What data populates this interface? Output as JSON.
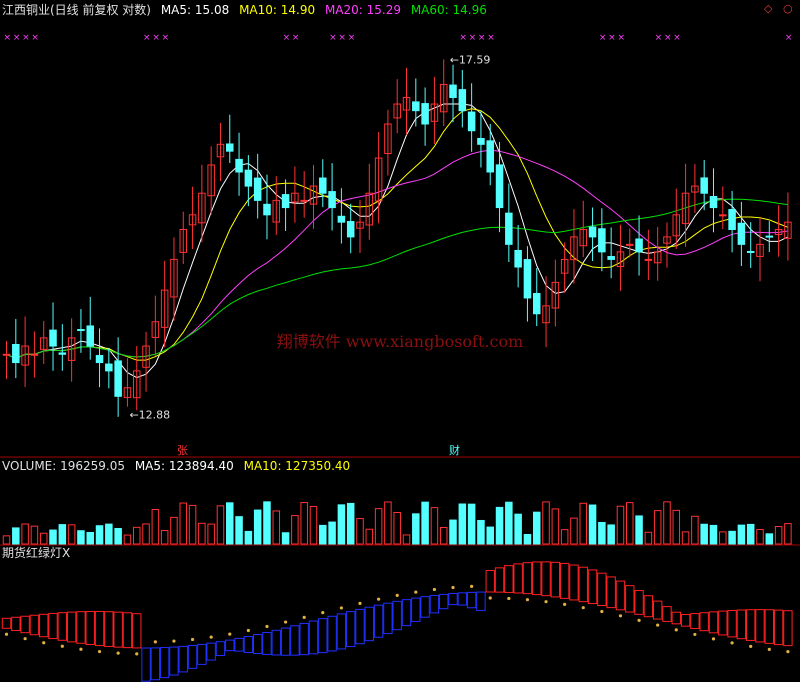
{
  "header": {
    "symbol": "江西铜业(日线 前复权 对数)",
    "ma5": "MA5: 15.08",
    "ma10": "MA10: 14.90",
    "ma20": "MA20: 15.29",
    "ma60": "MA60: 14.96"
  },
  "volume_header": {
    "volume": "VOLUME: 196259.05",
    "ma5": "MA5: 123894.40",
    "ma10": "MA10: 127350.40"
  },
  "indicator_header": {
    "name": "期货红绿灯X"
  },
  "watermark": "翔博软件 www.xiangbosoft.com",
  "markers": {
    "zhang": "张",
    "cai": "财"
  },
  "icons": {
    "top_right": [
      "diamond-icon",
      "circle-icon"
    ]
  },
  "colors": {
    "up": "#ff3232",
    "down": "#54ffff",
    "ma5": "#ffffff",
    "ma10": "#ffff00",
    "ma20": "#ff40ff",
    "ma60": "#00e000",
    "grid": "#a00000",
    "signal": "#ff40ff",
    "ind_red": "#ff2020",
    "ind_blue": "#2030ff",
    "ind_gold": "#e0b040"
  },
  "chart_data": [
    {
      "type": "candlestick",
      "title": "江西铜业(日线 前复权 对数)",
      "annotations": [
        "17.59",
        "12.88"
      ],
      "high_label": "17.59",
      "low_label": "12.88",
      "high": 17.59,
      "low": 12.88,
      "ylim": [
        12.5,
        17.9
      ],
      "closes": [
        13.5,
        13.4,
        13.6,
        13.5,
        13.7,
        13.6,
        13.5,
        13.7,
        13.8,
        13.6,
        13.4,
        13.3,
        13.0,
        13.1,
        13.3,
        13.6,
        13.9,
        14.3,
        14.7,
        15.1,
        15.3,
        15.6,
        16.0,
        16.3,
        16.2,
        15.9,
        15.7,
        15.5,
        15.3,
        15.5,
        15.4,
        15.6,
        15.5,
        15.7,
        15.6,
        15.4,
        15.2,
        15.0,
        15.2,
        15.6,
        16.1,
        16.6,
        16.9,
        17.0,
        16.8,
        16.6,
        16.9,
        17.2,
        17.0,
        16.8,
        16.5,
        16.3,
        15.9,
        15.4,
        14.9,
        14.6,
        14.2,
        14.0,
        14.1,
        14.4,
        14.7,
        15.0,
        15.1,
        15.0,
        14.8,
        14.7,
        14.8,
        14.9,
        14.8,
        14.7,
        14.8,
        15.0,
        15.3,
        15.6,
        15.7,
        15.6,
        15.4,
        15.3,
        15.1,
        14.9,
        14.8,
        14.9,
        15.0,
        15.1,
        15.2
      ]
    },
    {
      "type": "line",
      "series": [
        {
          "name": "MA5",
          "value": 15.08
        },
        {
          "name": "MA10",
          "value": 14.9
        },
        {
          "name": "MA20",
          "value": 15.29
        },
        {
          "name": "MA60",
          "value": 14.96
        }
      ]
    },
    {
      "type": "bar",
      "title": "VOLUME",
      "last": 196259.05,
      "ma5": 123894.4,
      "ma10": 127350.4
    },
    {
      "type": "area",
      "title": "期货红绿灯X"
    }
  ]
}
